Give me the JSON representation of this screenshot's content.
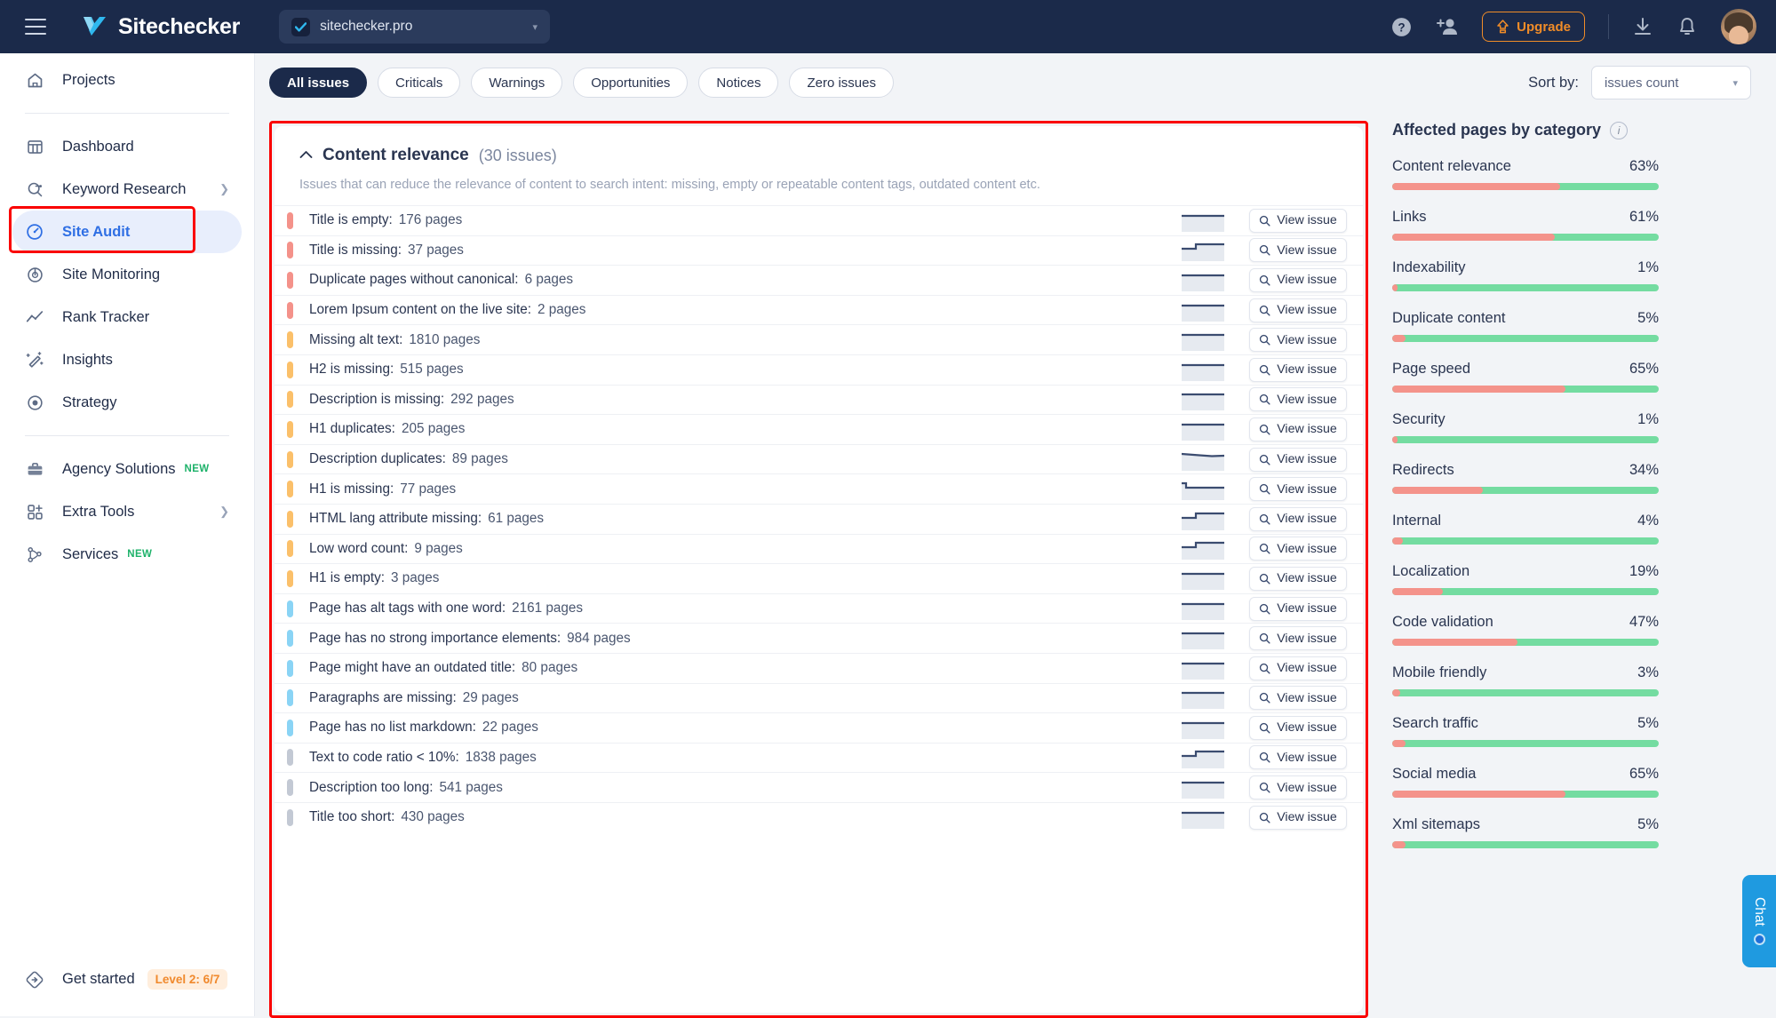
{
  "topbar": {
    "menu_icon": "hamburger-icon",
    "brand": "Sitechecker",
    "site_selector": {
      "value": "sitechecker.pro"
    },
    "help_icon": "help-circle-icon",
    "invite_icon": "add-user-icon",
    "upgrade_label": "Upgrade",
    "download_icon": "download-icon",
    "bell_icon": "notification-bell-icon",
    "avatar": "user-avatar"
  },
  "sidebar": {
    "projects": {
      "label": "Projects",
      "icon": "home-icon"
    },
    "items": [
      {
        "label": "Dashboard",
        "icon": "dashboard-icon",
        "active": false,
        "chevron": false,
        "badge": ""
      },
      {
        "label": "Keyword Research",
        "icon": "keyword-search-icon",
        "active": false,
        "chevron": true,
        "badge": ""
      },
      {
        "label": "Site Audit",
        "icon": "site-audit-icon",
        "active": true,
        "chevron": false,
        "badge": ""
      },
      {
        "label": "Site Monitoring",
        "icon": "site-monitoring-icon",
        "active": false,
        "chevron": false,
        "badge": ""
      },
      {
        "label": "Rank Tracker",
        "icon": "rank-tracker-icon",
        "active": false,
        "chevron": false,
        "badge": ""
      },
      {
        "label": "Insights",
        "icon": "insights-icon",
        "active": false,
        "chevron": false,
        "badge": ""
      },
      {
        "label": "Strategy",
        "icon": "strategy-icon",
        "active": false,
        "chevron": false,
        "badge": ""
      }
    ],
    "items2": [
      {
        "label": "Agency Solutions",
        "icon": "briefcase-icon",
        "chevron": false,
        "badge": "NEW"
      },
      {
        "label": "Extra Tools",
        "icon": "extra-tools-icon",
        "chevron": true,
        "badge": ""
      },
      {
        "label": "Services",
        "icon": "services-icon",
        "chevron": false,
        "badge": "NEW"
      }
    ],
    "get_started": {
      "label": "Get started",
      "icon": "get-started-icon",
      "level": "Level 2: 6/7"
    }
  },
  "toolbar": {
    "filters": [
      {
        "label": "All issues",
        "active": true
      },
      {
        "label": "Criticals",
        "active": false
      },
      {
        "label": "Warnings",
        "active": false
      },
      {
        "label": "Opportunities",
        "active": false
      },
      {
        "label": "Notices",
        "active": false
      },
      {
        "label": "Zero issues",
        "active": false
      }
    ],
    "sort_label": "Sort by:",
    "sort_value": "issues count"
  },
  "card": {
    "title": "Content relevance",
    "issues_count": "(30 issues)",
    "collapse_icon": "chevron-up-icon",
    "description": "Issues that can reduce the relevance of content to search intent: missing, empty or repeatable content tags, outdated content etc.",
    "view_issue_label": "View issue",
    "search_icon": "magnifier-icon",
    "rows": [
      {
        "label": "Title is empty:",
        "count": "176 pages",
        "severity": "critical",
        "spark": "flat"
      },
      {
        "label": "Title is missing:",
        "count": "37 pages",
        "severity": "critical",
        "spark": "step"
      },
      {
        "label": "Duplicate pages without canonical:",
        "count": "6 pages",
        "severity": "critical",
        "spark": "flat"
      },
      {
        "label": "Lorem Ipsum content on the live site:",
        "count": "2 pages",
        "severity": "critical",
        "spark": "flat"
      },
      {
        "label": "Missing alt text:",
        "count": "1810 pages",
        "severity": "warning",
        "spark": "flat"
      },
      {
        "label": "H2 is missing:",
        "count": "515 pages",
        "severity": "warning",
        "spark": "flat"
      },
      {
        "label": "Description is missing:",
        "count": "292 pages",
        "severity": "warning",
        "spark": "flat"
      },
      {
        "label": "H1 duplicates:",
        "count": "205 pages",
        "severity": "warning",
        "spark": "flat"
      },
      {
        "label": "Description duplicates:",
        "count": "89 pages",
        "severity": "warning",
        "spark": "dip"
      },
      {
        "label": "H1 is missing:",
        "count": "77 pages",
        "severity": "warning",
        "spark": "notch"
      },
      {
        "label": "HTML lang attribute missing:",
        "count": "61 pages",
        "severity": "warning",
        "spark": "step"
      },
      {
        "label": "Low word count:",
        "count": "9 pages",
        "severity": "warning",
        "spark": "step"
      },
      {
        "label": "H1 is empty:",
        "count": "3 pages",
        "severity": "warning",
        "spark": "flat"
      },
      {
        "label": "Page has alt tags with one word:",
        "count": "2161 pages",
        "severity": "opportunity",
        "spark": "flat"
      },
      {
        "label": "Page has no strong importance elements:",
        "count": "984 pages",
        "severity": "opportunity",
        "spark": "flat"
      },
      {
        "label": "Page might have an outdated title:",
        "count": "80 pages",
        "severity": "opportunity",
        "spark": "flat"
      },
      {
        "label": "Paragraphs are missing:",
        "count": "29 pages",
        "severity": "opportunity",
        "spark": "flat"
      },
      {
        "label": "Page has no list markdown:",
        "count": "22 pages",
        "severity": "opportunity",
        "spark": "flat"
      },
      {
        "label": "Text to code ratio < 10%:",
        "count": "1838 pages",
        "severity": "notice",
        "spark": "step"
      },
      {
        "label": "Description too long:",
        "count": "541 pages",
        "severity": "notice",
        "spark": "flat"
      },
      {
        "label": "Title too short:",
        "count": "430 pages",
        "severity": "notice",
        "spark": "flat"
      }
    ]
  },
  "right_panel": {
    "title": "Affected pages by category",
    "info_icon": "info-icon",
    "categories": [
      {
        "name": "Content relevance",
        "pct": "63%",
        "value": 63
      },
      {
        "name": "Links",
        "pct": "61%",
        "value": 61
      },
      {
        "name": "Indexability",
        "pct": "1%",
        "value": 1
      },
      {
        "name": "Duplicate content",
        "pct": "5%",
        "value": 5
      },
      {
        "name": "Page speed",
        "pct": "65%",
        "value": 65
      },
      {
        "name": "Security",
        "pct": "1%",
        "value": 1
      },
      {
        "name": "Redirects",
        "pct": "34%",
        "value": 34
      },
      {
        "name": "Internal",
        "pct": "4%",
        "value": 4
      },
      {
        "name": "Localization",
        "pct": "19%",
        "value": 19
      },
      {
        "name": "Code validation",
        "pct": "47%",
        "value": 47
      },
      {
        "name": "Mobile friendly",
        "pct": "3%",
        "value": 3
      },
      {
        "name": "Search traffic",
        "pct": "5%",
        "value": 5
      },
      {
        "name": "Social media",
        "pct": "65%",
        "value": 65
      },
      {
        "name": "Xml sitemaps",
        "pct": "5%",
        "value": 5
      }
    ]
  },
  "chat": {
    "label": "Chat",
    "icon": "chat-status-dot"
  },
  "colors": {
    "critical": "#f4928a",
    "warning": "#fbc06a",
    "opportunity": "#8ad4f5",
    "notice": "#c3c9d4",
    "accent": "#2f6fe4",
    "upgrade": "#f08c28",
    "bar_red": "#f4938b",
    "bar_green": "#74dca1",
    "highlight": "#fa0000"
  }
}
